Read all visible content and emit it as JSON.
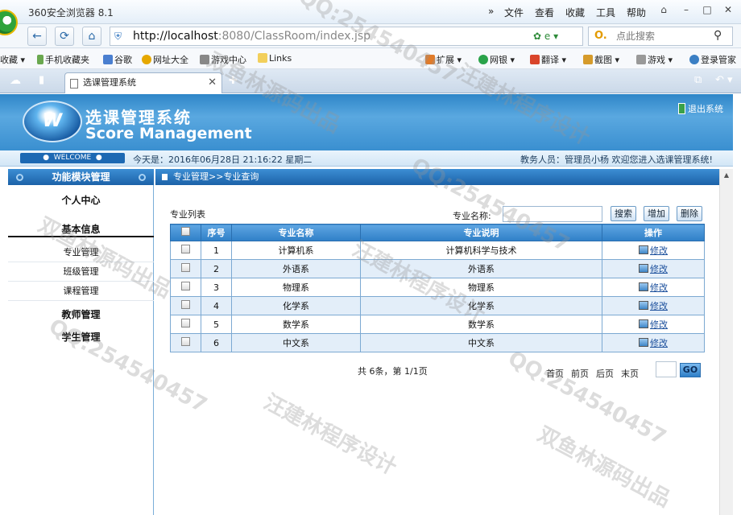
{
  "browser": {
    "title": "360安全浏览器 8.1",
    "menus": [
      "文件",
      "查看",
      "收藏",
      "工具",
      "帮助"
    ],
    "url_host": "http://localhost",
    "url_rest": ":8080/ClassRoom/index.jsp",
    "search_placeholder": "点此搜索",
    "favorites_left": [
      "收藏",
      "手机收藏夹",
      "谷歌",
      "网址大全",
      "游戏中心",
      "Links"
    ],
    "favorites_right": [
      "扩展",
      "网银",
      "翻译",
      "截图",
      "游戏",
      "登录管家"
    ],
    "tab_title": "选课管理系统"
  },
  "header": {
    "title": "选课管理系统",
    "subtitle": "Score Management",
    "logout": "退出系统",
    "welcome": "WELCOME",
    "today": "今天是：2016年06月28日   21:16:22   星期二",
    "user_info": "教务人员：管理员小杨   欢迎您进入选课管理系统!"
  },
  "left_menu": {
    "header": "功能模块管理",
    "personal_center": "个人中心",
    "basic_info": "基本信息",
    "items": [
      "专业管理",
      "班级管理",
      "课程管理"
    ],
    "teacher_mgmt": "教师管理",
    "student_mgmt": "学生管理"
  },
  "main": {
    "breadcrumb": "专业管理>>专业查询",
    "list_title": "专业列表",
    "search_label": "专业名称:",
    "search_value": "",
    "buttons": {
      "search": "搜索",
      "add": "增加",
      "delete": "删除"
    },
    "columns": [
      "序号",
      "专业名称",
      "专业说明",
      "操作"
    ],
    "rows": [
      {
        "no": "1",
        "name": "计算机系",
        "desc": "计算机科学与技术",
        "action": "修改"
      },
      {
        "no": "2",
        "name": "外语系",
        "desc": "外语系",
        "action": "修改"
      },
      {
        "no": "3",
        "name": "物理系",
        "desc": "物理系",
        "action": "修改"
      },
      {
        "no": "4",
        "name": "化学系",
        "desc": "化学系",
        "action": "修改"
      },
      {
        "no": "5",
        "name": "数学系",
        "desc": "数学系",
        "action": "修改"
      },
      {
        "no": "6",
        "name": "中文系",
        "desc": "中文系",
        "action": "修改"
      }
    ],
    "summary": "共 6条，第 1/1页",
    "pager": {
      "first": "首页",
      "prev": "前页",
      "next": "后页",
      "last": "末页",
      "go": "GO"
    }
  },
  "watermarks": [
    "QQ:254540457",
    "汪建林程序设计",
    "双鱼林源码出品"
  ]
}
